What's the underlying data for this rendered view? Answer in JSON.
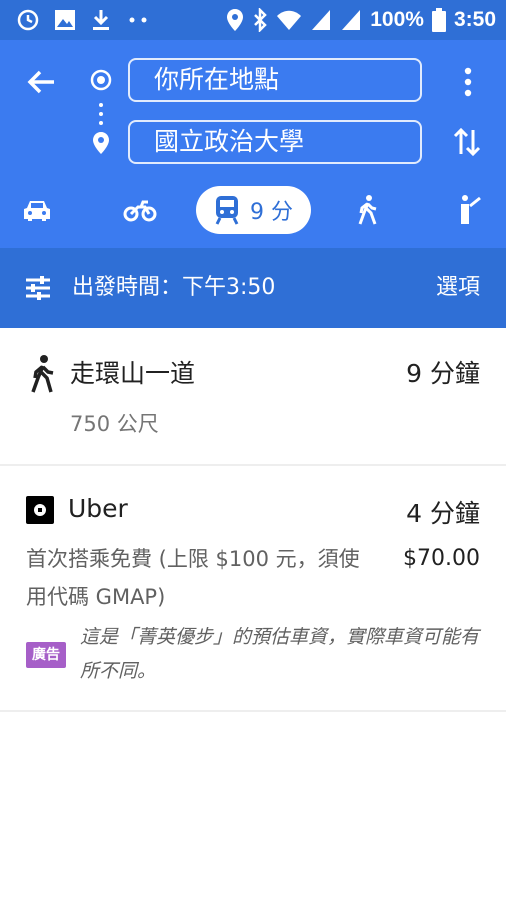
{
  "status_bar": {
    "battery": "100%",
    "time": "3:50",
    "icons": [
      "sync-icon",
      "image-icon",
      "download-icon",
      "more-dots-icon",
      "location-icon",
      "bluetooth-icon",
      "wifi-icon",
      "signal-icon",
      "signal-icon",
      "battery-icon"
    ]
  },
  "header": {
    "origin": "你所在地點",
    "destination": "國立政治大學",
    "colors": {
      "header": "#3b7bf0",
      "status": "#2f6fd6"
    }
  },
  "modes": [
    {
      "name": "car-icon"
    },
    {
      "name": "motorcycle-icon"
    },
    {
      "name": "transit-icon",
      "label": "9 分",
      "selected": true
    },
    {
      "name": "walk-icon"
    },
    {
      "name": "ride-hail-icon"
    }
  ],
  "depart": {
    "label": "出發時間：下午3:50",
    "options": "選項"
  },
  "walk_route": {
    "title": "走環山一道",
    "duration": "9 分鐘",
    "distance": "750 公尺"
  },
  "uber_route": {
    "title": "Uber",
    "duration": "4 分鐘",
    "description": "首次搭乘免費 (上限 $100 元，須使用代碼 GMAP)",
    "price": "$70.00",
    "ad_badge": "廣告",
    "disclaimer": "這是「菁英優步」的預估車資，實際車資可能有所不同。"
  }
}
